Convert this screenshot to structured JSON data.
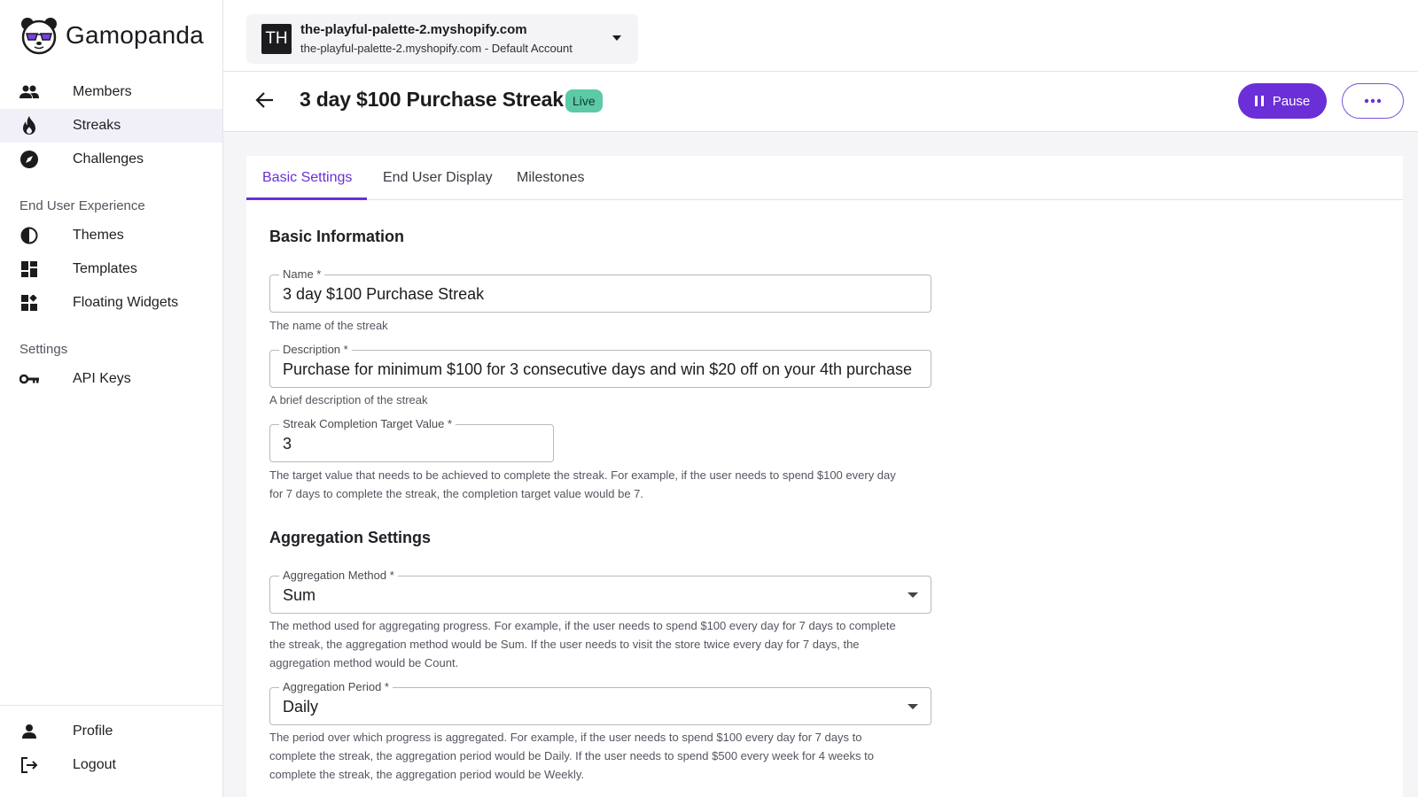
{
  "brand": {
    "name": "Gamopanda"
  },
  "sidebar": {
    "items": [
      {
        "label": "Members",
        "icon": "members-icon"
      },
      {
        "label": "Streaks",
        "icon": "flame-icon",
        "active": true
      },
      {
        "label": "Challenges",
        "icon": "compass-icon"
      }
    ],
    "sections": [
      {
        "title": "End User Experience",
        "items": [
          {
            "label": "Themes",
            "icon": "contrast-icon"
          },
          {
            "label": "Templates",
            "icon": "dashboard-icon"
          },
          {
            "label": "Floating Widgets",
            "icon": "widgets-icon"
          }
        ]
      },
      {
        "title": "Settings",
        "items": [
          {
            "label": "API Keys",
            "icon": "key-icon"
          }
        ]
      }
    ],
    "bottom": [
      {
        "label": "Profile",
        "icon": "person-icon"
      },
      {
        "label": "Logout",
        "icon": "logout-icon"
      }
    ]
  },
  "store": {
    "avatar": "TH",
    "primary": "the-playful-palette-2.myshopify.com",
    "secondary": "the-playful-palette-2.myshopify.com - Default Account"
  },
  "header": {
    "title": "3 day $100 Purchase Streak",
    "status": "Live",
    "pause_label": "Pause"
  },
  "tabs": [
    "Basic Settings",
    "End User Display",
    "Milestones"
  ],
  "basic_info": {
    "title": "Basic Information",
    "name": {
      "label": "Name *",
      "value": "3 day $100 Purchase Streak",
      "helper": "The name of the streak"
    },
    "description": {
      "label": "Description *",
      "value": "Purchase for minimum $100 for 3 consecutive days and win $20 off on your 4th purchase",
      "helper": "A brief description of the streak"
    },
    "target": {
      "label": "Streak Completion Target Value *",
      "value": "3",
      "helper_line1": "The target value that needs to be achieved to complete the streak. For example, if the user needs to spend $100 every day",
      "helper_line2": "for 7 days to complete the streak, the completion target value would be 7."
    }
  },
  "aggregation": {
    "title": "Aggregation Settings",
    "method": {
      "label": "Aggregation Method *",
      "value": "Sum",
      "helper_line1": "The method used for aggregating progress. For example, if the user needs to spend $100 every day for 7 days to complete",
      "helper_line2": "the streak, the aggregation method would be Sum. If the user needs to visit the store twice every day for 7 days, the",
      "helper_line3": "aggregation method would be Count."
    },
    "period": {
      "label": "Aggregation Period *",
      "value": "Daily",
      "helper_line1": "The period over which progress is aggregated. For example, if the user needs to spend $100 every day for 7 days to",
      "helper_line2": "complete the streak, the aggregation period would be Daily. If the user needs to spend $500 every week for 4 weeks to",
      "helper_line3": "complete the streak, the aggregation period would be Weekly."
    }
  },
  "colors": {
    "accent": "#6a2fd6",
    "live_badge": "#5cc9a7",
    "active_nav_bg": "#f1f0f8"
  }
}
